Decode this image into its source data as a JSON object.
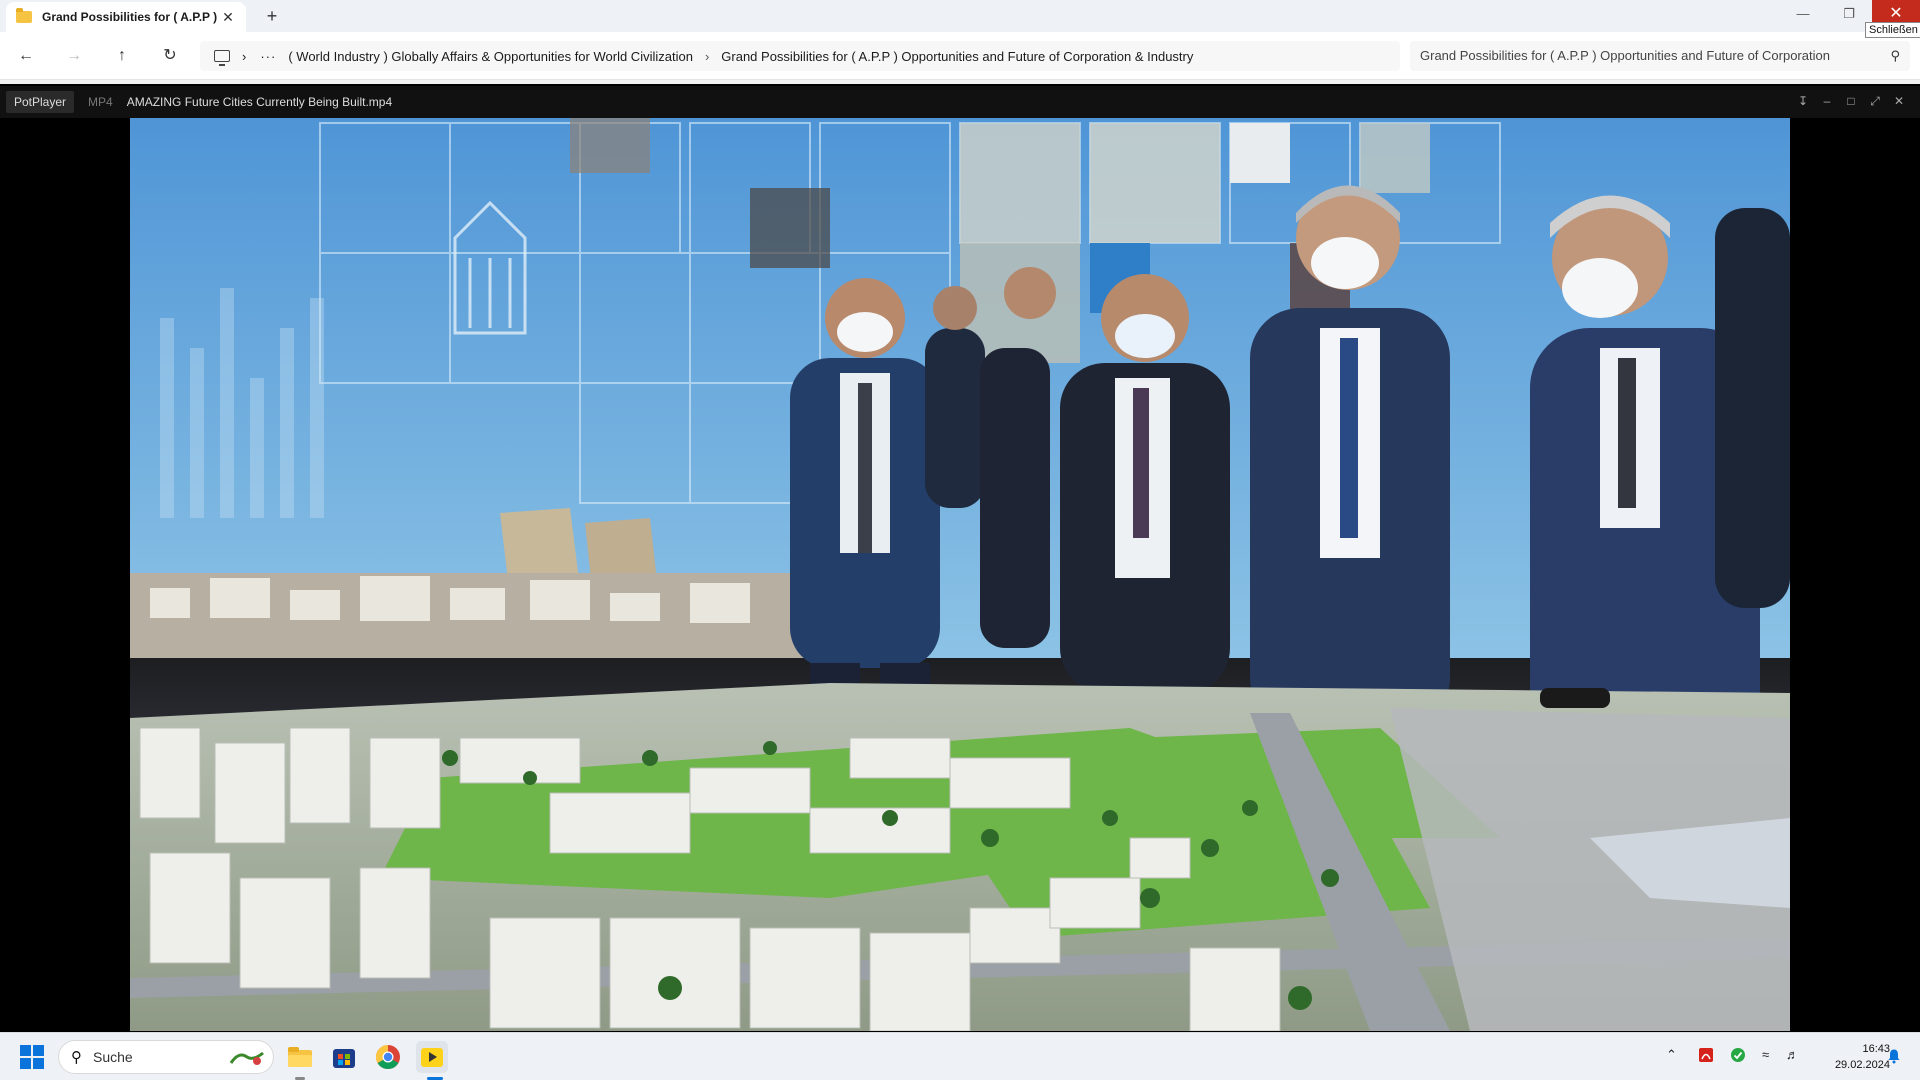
{
  "explorer": {
    "tab_title": "Grand Possibilities for ( A.P.P )",
    "tab_close": "✕",
    "new_tab": "+",
    "close_tooltip": "Schließen",
    "breadcrumb_more": "···",
    "breadcrumb_1": "( World Industry ) Globally Affairs & Opportunities for World Civilization",
    "breadcrumb_2": "Grand Possibilities for ( A.P.P ) Opportunities and Future of Corporation & Industry",
    "search_text": "Grand Possibilities for ( A.P.P ) Opportunities and Future of Corporation"
  },
  "player": {
    "brand": "PotPlayer",
    "format": "MP4",
    "filename": "AMAZING Future Cities Currently Being Built.mp4"
  },
  "taskbar": {
    "search_label": "Suche",
    "time": "16:43",
    "date": "29.02.2024"
  },
  "colors": {
    "close_red": "#c42b1c",
    "windows_blue": "#0a74da",
    "player_bg": "#111111"
  }
}
